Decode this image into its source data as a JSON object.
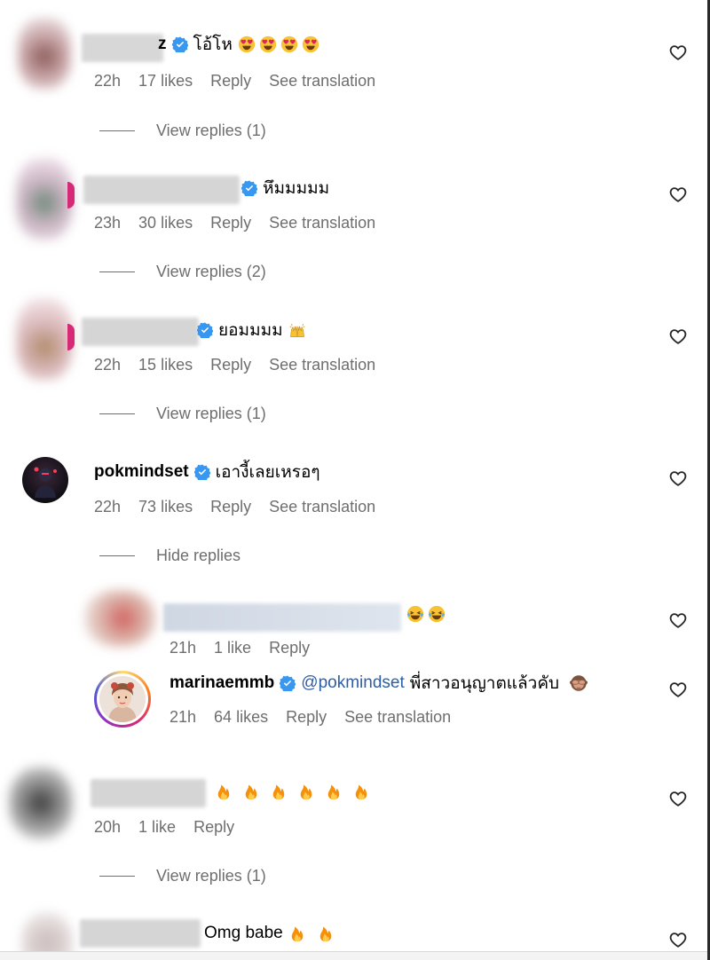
{
  "comments": [
    {
      "text": "โอ้โห",
      "emojis": [
        "heart-eyes",
        "heart-eyes",
        "heart-eyes",
        "heart-eyes"
      ],
      "name_tail": "z",
      "time": "22h",
      "likes": "17 likes",
      "reply": "Reply",
      "translation": "See translation",
      "replies_toggle": "View replies (1)"
    },
    {
      "text": "หึมมมมม",
      "time": "23h",
      "likes": "30 likes",
      "reply": "Reply",
      "translation": "See translation",
      "replies_toggle": "View replies (2)"
    },
    {
      "text": "ยอมมมม",
      "emojis": [
        "raising-hands"
      ],
      "time": "22h",
      "likes": "15 likes",
      "reply": "Reply",
      "translation": "See translation",
      "replies_toggle": "View replies (1)"
    },
    {
      "username": "pokmindset",
      "text": "เอางี้เลยเหรอๆ",
      "time": "22h",
      "likes": "73 likes",
      "reply": "Reply",
      "translation": "See translation",
      "replies_toggle": "Hide replies",
      "replies": [
        {
          "emojis": [
            "laughing-tears",
            "laughing-tears"
          ],
          "time": "21h",
          "likes": "1 like",
          "reply": "Reply"
        },
        {
          "username": "marinaemmb",
          "mention": "@pokmindset",
          "text": "พี่สาวอนุญาตแล้วคับ",
          "emojis": [
            "see-no-evil-monkey"
          ],
          "time": "21h",
          "likes": "64 likes",
          "reply": "Reply",
          "translation": "See translation"
        }
      ]
    },
    {
      "emojis": [
        "fire",
        "fire",
        "fire",
        "fire",
        "fire",
        "fire"
      ],
      "time": "20h",
      "likes": "1 like",
      "reply": "Reply",
      "replies_toggle": "View replies (1)"
    },
    {
      "text": "Omg babe",
      "emojis": [
        "fire",
        "fire"
      ]
    }
  ],
  "colors": {
    "verified": "#3897f0",
    "meta_text": "#6e6e6e",
    "mention": "#2c5fa8"
  }
}
